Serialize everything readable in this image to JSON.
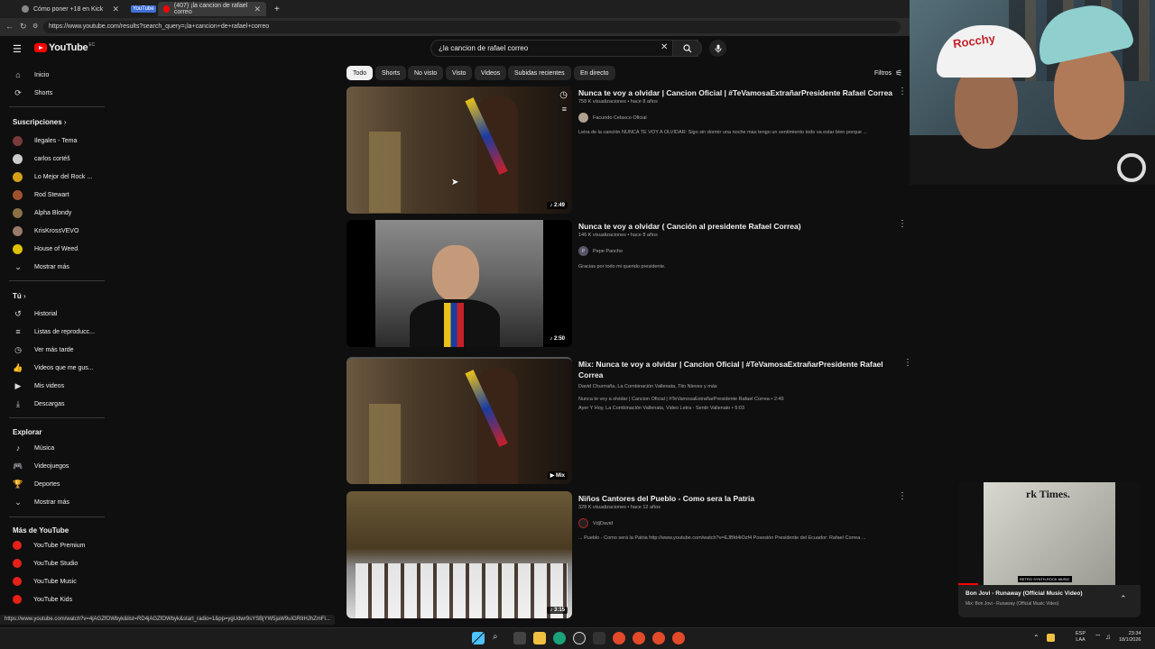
{
  "browser": {
    "tabs": [
      {
        "label": "Cómo poner +18 en Kick",
        "close": "✕"
      },
      {
        "label": "YouTube"
      },
      {
        "label": "(407) ¡la cancion de rafael correo",
        "close": "✕"
      }
    ],
    "new_tab": "+",
    "url": "https://www.youtube.com/results?search_query=¡la+cancion+de+rafael+correo"
  },
  "header": {
    "logo_text": "YouTube",
    "logo_country": "EC",
    "search_value": "¿la cancion de rafael correo",
    "clear_icon": "✕",
    "search_icon": "⌕",
    "mic_icon": "🎙"
  },
  "chips": [
    "Todo",
    "Shorts",
    "No visto",
    "Visto",
    "Videos",
    "Subidas recientes",
    "En directo"
  ],
  "filters_label": "Filtros",
  "sidebar": {
    "main": [
      {
        "label": "Inicio",
        "icon": "⌂"
      },
      {
        "label": "Shorts",
        "icon": "⟳"
      }
    ],
    "subs_header": "Suscripciones",
    "subs": [
      {
        "label": "Ilegales - Tema",
        "color": "#7a3b3b"
      },
      {
        "label": "carlos cortéš",
        "color": "#cccccc"
      },
      {
        "label": "Lo Mejor del Rock ...",
        "color": "#d4a017"
      },
      {
        "label": "Rod Stewart",
        "color": "#a0522d"
      },
      {
        "label": "Alpha Blondy",
        "color": "#8b6f47"
      },
      {
        "label": "KrisKrossVEVO",
        "color": "#9a7a6a"
      },
      {
        "label": "House of Weed",
        "color": "#e0c000"
      }
    ],
    "subs_more": "Mostrar más",
    "you_header": "Tú",
    "you": [
      {
        "label": "Historial",
        "icon": "↺"
      },
      {
        "label": "Listas de reproducc...",
        "icon": "≡"
      },
      {
        "label": "Ver más tarde",
        "icon": "◷"
      },
      {
        "label": "Videos que me gus...",
        "icon": "👍"
      },
      {
        "label": "Mis videos",
        "icon": "▶"
      },
      {
        "label": "Descargas",
        "icon": "⤓"
      }
    ],
    "explore_header": "Explorar",
    "explore": [
      {
        "label": "Música",
        "icon": "♪"
      },
      {
        "label": "Videojuegos",
        "icon": "🎮"
      },
      {
        "label": "Deportes",
        "icon": "🏆"
      }
    ],
    "explore_more": "Mostrar más",
    "more_header": "Más de YouTube",
    "more": [
      {
        "label": "YouTube Premium"
      },
      {
        "label": "YouTube Studio"
      },
      {
        "label": "YouTube Music"
      },
      {
        "label": "YouTube Kids"
      }
    ]
  },
  "results": [
    {
      "title": "Nunca te voy a olvidar | Cancion Oficial | #TeVamosaExtrañarPresidente Rafael Correa",
      "meta": "758 K visualizaciones • hace 8 años",
      "channel": "Facundo Celasco Oficial",
      "desc": "Letra de la canción NUNCA TE VOY A OLVIDAR: Sigo sin dormir una noche mas tengo un sentimiento todo va estar bien porque ...",
      "duration": "♪ 2:49"
    },
    {
      "title": "Nunca te voy a olvidar ( Canción al presidente Rafael Correa)",
      "meta": "146 K visualizaciones • hace 8 años",
      "channel": "Pepe Pancho",
      "channel_initial": "P",
      "desc": "Gracias por todo mi querido presidente.",
      "duration": "♪ 2:50"
    },
    {
      "title": "Mix: Nunca te voy a olvidar | Cancion Oficial | #TeVamosaExtrañarPresidente Rafael Correa",
      "meta": "David Churrraña, La Combinación Vallenata, Tito Nieves y más",
      "desc_line1": "Nunca te voy a olvidar | Cancion Oficial | #TeVamosaExtrañarPresidente Rafael Correa • 2:49",
      "desc_line2": "Ayer Y Hoy, La Combinación Vallenata, Video Letra - Sentir Vallenato • 5:03",
      "duration": "▶ Mix"
    },
    {
      "title": "Niños Cantores del Pueblo - Como sera la Patria",
      "meta": "328 K visualizaciones • hace 12 años",
      "channel": "VdjDavid",
      "desc": "... Pueblo - Como será la Patria http://www.youtube.com/watch?v=EJBfd4iOzf4 Posesión Presidente del Ecuador: Rafael Correa ...",
      "duration": "♪ 3:15"
    }
  ],
  "miniplayer": {
    "title": "Bon Jovi - Runaway (Official Music Video)",
    "subtitle": "Mix: Bon Jovi - Runaway (Official Music Video)",
    "overlay_label": "RETRO SYNTH-ROCK MUSIC",
    "newspaper_text": "rk Times."
  },
  "webcam": {
    "cap_text": "Rocchy"
  },
  "status_url": "https://www.youtube.com/watch?v=4jAGZfOWbyk&list=RD4jAGZfOWbyk&start_radio=1&pp=ygUdwr9sYSBjYW5jaW9uIGRIIHJhZmFl...",
  "taskbar": {
    "lang": "ESP",
    "lang2": "LAA",
    "time": "23:34",
    "date": "18/1/2026"
  }
}
